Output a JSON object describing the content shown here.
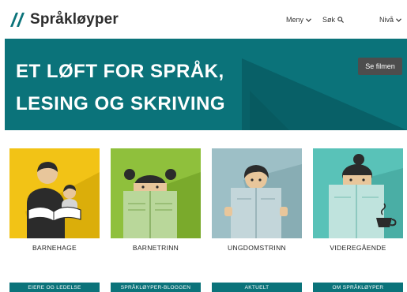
{
  "header": {
    "brand": "Språkløyper",
    "nav": {
      "meny": "Meny",
      "sok": "Søk",
      "niva": "Nivå"
    }
  },
  "hero": {
    "line1": "ET LØFT FOR SPRÅK,",
    "line2": "LESING OG SKRIVING",
    "film_button": "Se filmen"
  },
  "cards": [
    {
      "label": "BARNEHAGE"
    },
    {
      "label": "BARNETRINN"
    },
    {
      "label": "UNGDOMSTRINN"
    },
    {
      "label": "VIDEREGÅENDE"
    }
  ],
  "bottom_links": [
    "EIERE OG LEDELSE",
    "SPRÅKLØYPER-BLOGGEN",
    "AKTUELT",
    "OM SPRÅKLØYPER"
  ],
  "colors": {
    "teal": "#0b737a",
    "yellow": "#f2c316",
    "green": "#8fc03c",
    "gray_blue": "#9dbfc6",
    "aqua": "#59c2b8"
  }
}
